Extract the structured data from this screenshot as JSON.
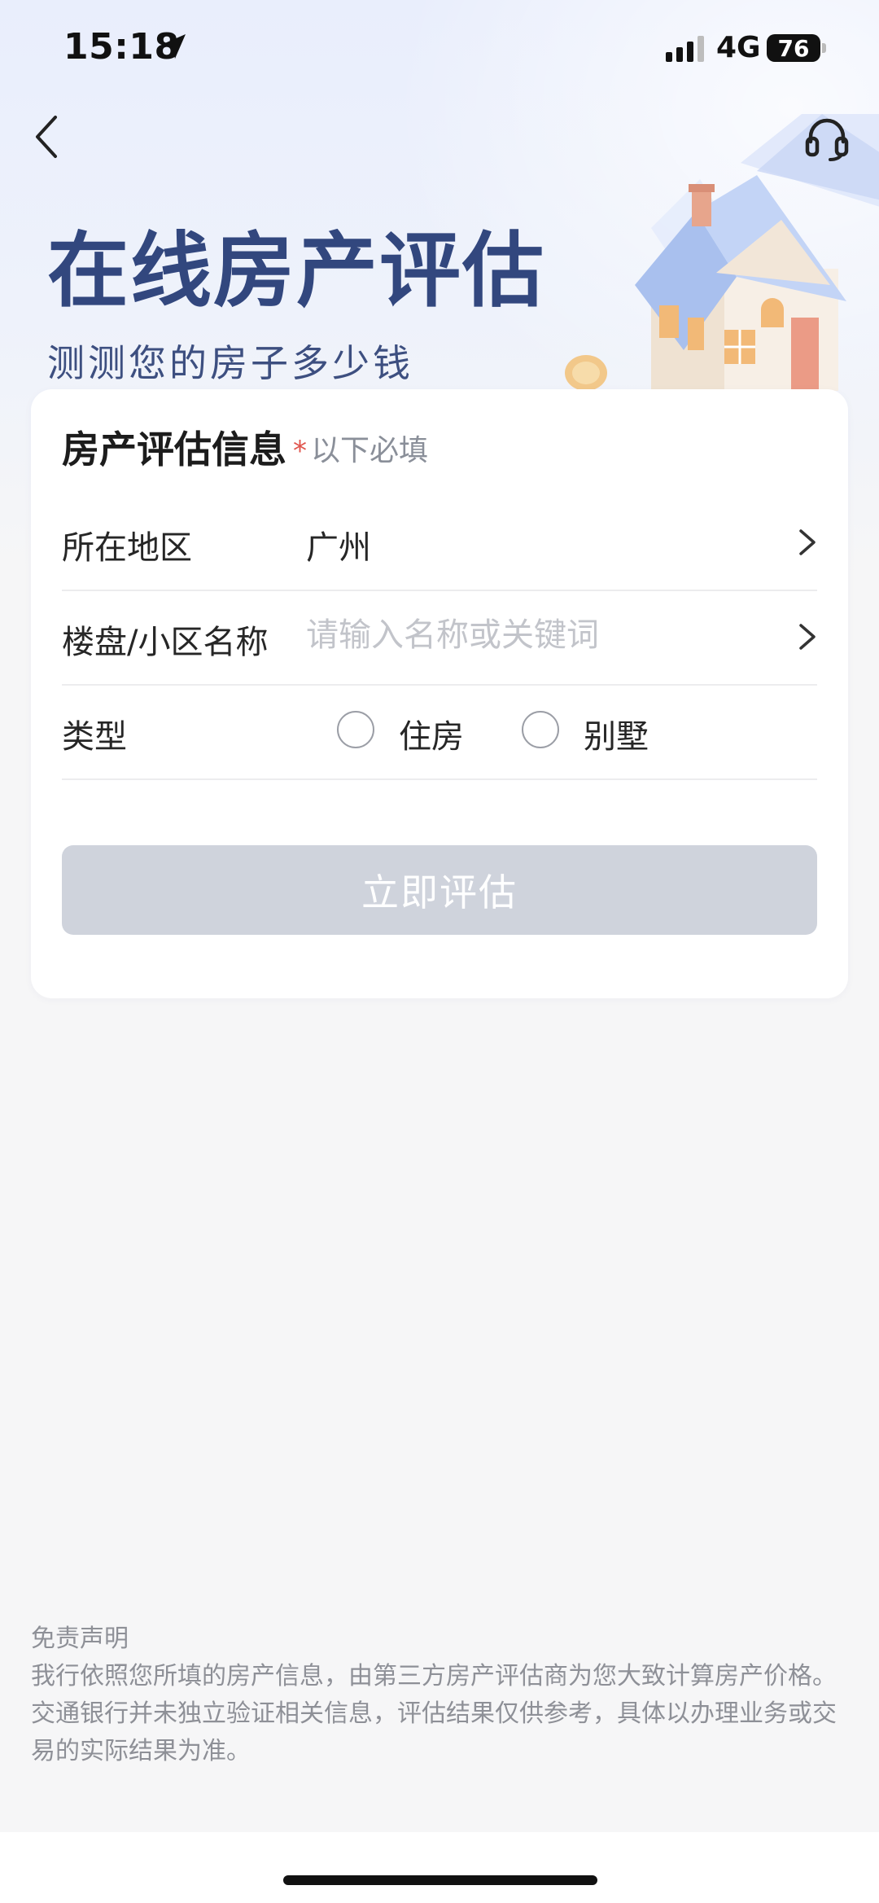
{
  "status_bar": {
    "time": "15:18",
    "network": "4G",
    "battery": "76"
  },
  "header": {
    "title": "在线房产评估",
    "subtitle": "测测您的房子多少钱",
    "back_icon": "chevron-left-icon",
    "service_icon": "headset-icon"
  },
  "form": {
    "title": "房产评估信息",
    "required_star": "*",
    "required_note": "以下必填",
    "region": {
      "label": "所在地区",
      "value": "广州"
    },
    "estate": {
      "label": "楼盘/小区名称",
      "value": "",
      "placeholder": "请输入名称或关键词"
    },
    "type": {
      "label": "类型",
      "options": [
        "住房",
        "别墅"
      ]
    },
    "submit_label": "立即评估"
  },
  "disclaimer": {
    "title": "免责声明",
    "body": "我行依照您所填的房产信息，由第三方房产评估商为您大致计算房产价格。交通银行并未独立验证相关信息，评估结果仅供参考，具体以办理业务或交易的实际结果为准。"
  },
  "colors": {
    "title": "#32477e",
    "button_disabled": "#cfd3dc",
    "required_star": "#e0554d",
    "placeholder": "#c2c4ca"
  }
}
